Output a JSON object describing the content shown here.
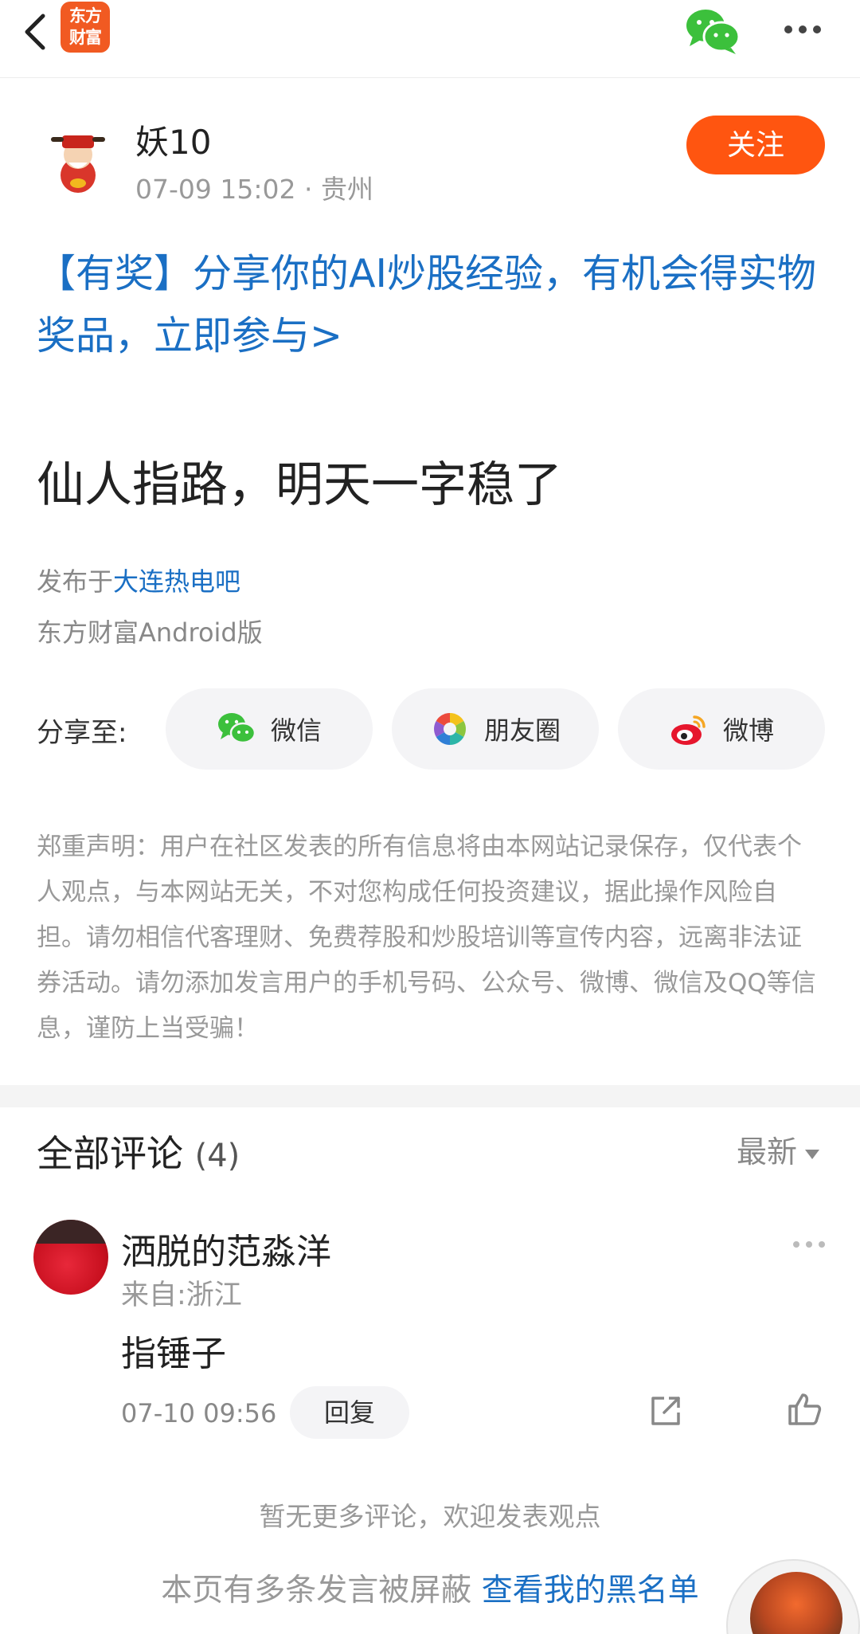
{
  "topbar": {
    "logo_line1": "东方",
    "logo_line2": "财富"
  },
  "author": {
    "name": "妖10",
    "meta": "07-09 15:02 · 贵州",
    "follow_label": "关注"
  },
  "promo": {
    "text": "【有奖】分享你的AI炒股经验，有机会得实物奖品，立即参与>"
  },
  "post": {
    "title": "仙人指路，明天一字稳了",
    "published_prefix": "发布于",
    "forum": "大连热电吧",
    "client": "东方财富Android版"
  },
  "share": {
    "label": "分享至:",
    "buttons": [
      "微信",
      "朋友圈",
      "微博"
    ]
  },
  "disclaimer": "郑重声明：用户在社区发表的所有信息将由本网站记录保存，仅代表个人观点，与本网站无关，不对您构成任何投资建议，据此操作风险自担。请勿相信代客理财、免费荐股和炒股培训等宣传内容，远离非法证券活动。请勿添加发言用户的手机号码、公众号、微博、微信及QQ等信息，谨防上当受骗！",
  "comments": {
    "heading": "全部评论",
    "count": "(4)",
    "sort": "最新",
    "items": [
      {
        "user": "洒脱的范淼洋",
        "location": "来自:浙江",
        "text": "指锤子",
        "time": "07-10 09:56",
        "reply_label": "回复"
      }
    ],
    "no_more": "暂无更多评论，欢迎发表观点"
  },
  "blocked": {
    "text": "本页有多条发言被屏蔽",
    "link": "查看我的黑名单"
  },
  "colors": {
    "accent_orange": "#ff5510",
    "link_blue": "#1a6fc4",
    "wechat_green": "#3cc03c"
  }
}
